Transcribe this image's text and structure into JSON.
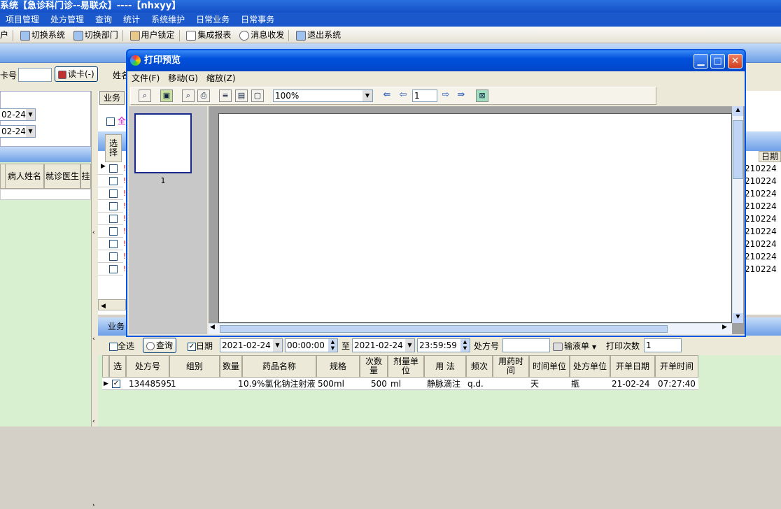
{
  "app": {
    "title": "系统【急诊科门诊--易联众】----【nhxyy】",
    "menu": [
      "项目管理",
      "处方管理",
      "查询",
      "统计",
      "系统维护",
      "日常业务",
      "日常事务"
    ],
    "toolbar": [
      "切换系统",
      "切换部门",
      "用户锁定",
      "集成报表",
      "消息收发",
      "退出系统"
    ],
    "toolbar_prefix": "户"
  },
  "card": {
    "label": "卡号",
    "value": "",
    "read_button": "读卡(-)",
    "name_label": "姓名"
  },
  "left": {
    "date1": "02-24",
    "date2": "02-24",
    "headers": [
      "病人姓名",
      "就诊医生",
      "挂"
    ]
  },
  "biz": {
    "tab": "业务",
    "select_all_partial": "全",
    "col_select": "选择",
    "col_date": "日期",
    "date_values": [
      "210224",
      "210224",
      "210224",
      "210224",
      "210224",
      "210224",
      "210224",
      "210224",
      "210224"
    ],
    "row_marks": [
      "!",
      "!",
      "!",
      "!",
      "!",
      "!",
      "!",
      "!",
      "!"
    ],
    "bottom_tab": "业务"
  },
  "filter": {
    "select_all": "全选",
    "query_button": "查询",
    "date_label": "日期",
    "date_from": "2021-02-24",
    "time_from": "00:00:00",
    "to_label": "至",
    "date_to": "2021-02-24",
    "time_to": "23:59:59",
    "rx_label": "处方号",
    "rx_value": "",
    "infusion_button": "输液单",
    "print_count_label": "打印次数",
    "print_count_value": "1"
  },
  "rx_table": {
    "headers": [
      "选",
      "处方号",
      "组别",
      "数量",
      "药品名称",
      "规格",
      "次数量",
      "剂量单位",
      "用 法",
      "频次",
      "用药时间",
      "时间单位",
      "处方单位",
      "开单日期",
      "开单时间"
    ],
    "rows": [
      [
        "",
        "13448595",
        "1",
        "1",
        "0.9%氯化钠注射液",
        "500ml",
        "500",
        "ml",
        "静脉滴注",
        "q.d.",
        "",
        "天",
        "瓶",
        "21-02-24",
        "07:27:40"
      ]
    ]
  },
  "preview": {
    "title": "打印预览",
    "menu": [
      "文件(F)",
      "移动(G)",
      "缩放(Z)"
    ],
    "zoom": "100%",
    "page": "1",
    "thumb_label": "1"
  }
}
